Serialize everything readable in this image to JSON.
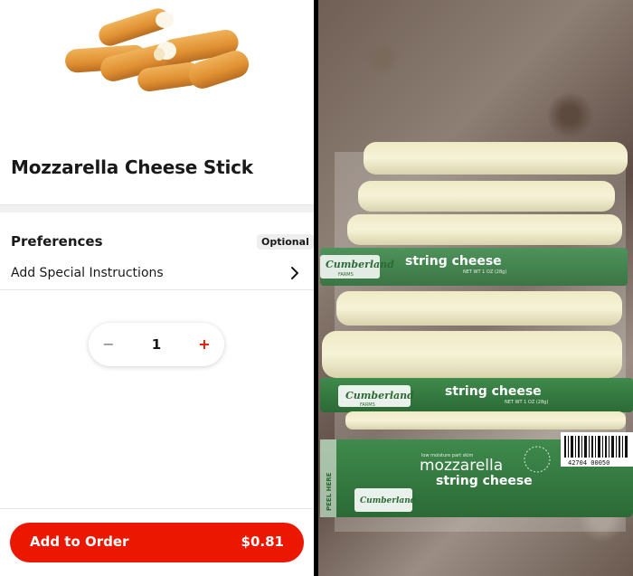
{
  "product": {
    "title": "Mozzarella Cheese Stick",
    "image_icon": "mozzarella-sticks-image"
  },
  "preferences": {
    "heading": "Preferences",
    "badge": "Optional",
    "special_instructions": "Add Special Instructions",
    "chevron_icon": "chevron-right-icon"
  },
  "quantity": {
    "minus": "−",
    "value": "1",
    "plus": "+"
  },
  "cta": {
    "label": "Add to Order",
    "price": "$0.81",
    "color": "#eb1700"
  },
  "photo": {
    "packages": [
      {
        "brand": "Cumberland",
        "brand_sub": "FARMS",
        "product": "string cheese",
        "net": "NET WT 1 OZ (28g)"
      },
      {
        "brand": "Cumberland",
        "brand_sub": "FARMS",
        "product": "string cheese",
        "net": "NET WT 1 OZ (28g)"
      },
      {
        "tagline": "low moisture part skim",
        "product_line1": "mozzarella",
        "product_line2": "string cheese",
        "brand": "Cumberland",
        "barcode": "42704 00050"
      }
    ],
    "side_text": "PEEL HERE"
  }
}
